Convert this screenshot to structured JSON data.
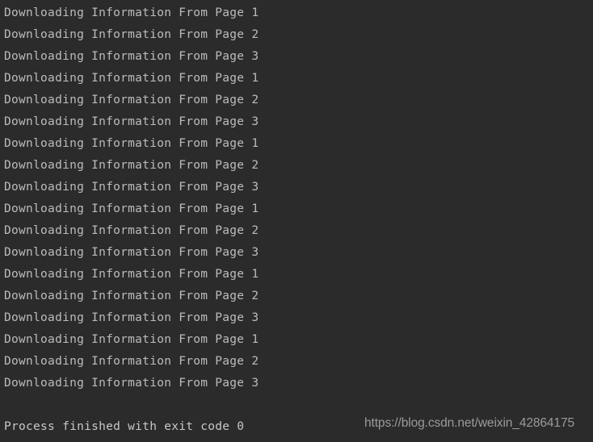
{
  "window": {
    "kind": "ide-run-console",
    "background_color": "#2b2b2b",
    "text_color": "#bcbcbc",
    "exit_text_color": "#c8c8c8",
    "watermark_color": "#9b9b9b"
  },
  "console": {
    "lines": [
      "Downloading Information From Page 1",
      "Downloading Information From Page 2",
      "Downloading Information From Page 3",
      "Downloading Information From Page 1",
      "Downloading Information From Page 2",
      "Downloading Information From Page 3",
      "Downloading Information From Page 1",
      "Downloading Information From Page 2",
      "Downloading Information From Page 3",
      "Downloading Information From Page 1",
      "Downloading Information From Page 2",
      "Downloading Information From Page 3",
      "Downloading Information From Page 1",
      "Downloading Information From Page 2",
      "Downloading Information From Page 3",
      "Downloading Information From Page 1",
      "Downloading Information From Page 2",
      "Downloading Information From Page 3"
    ],
    "blank_line": " ",
    "exit_message": "Process finished with exit code 0"
  },
  "watermark": {
    "text": "https://blog.csdn.net/weixin_42864175"
  }
}
